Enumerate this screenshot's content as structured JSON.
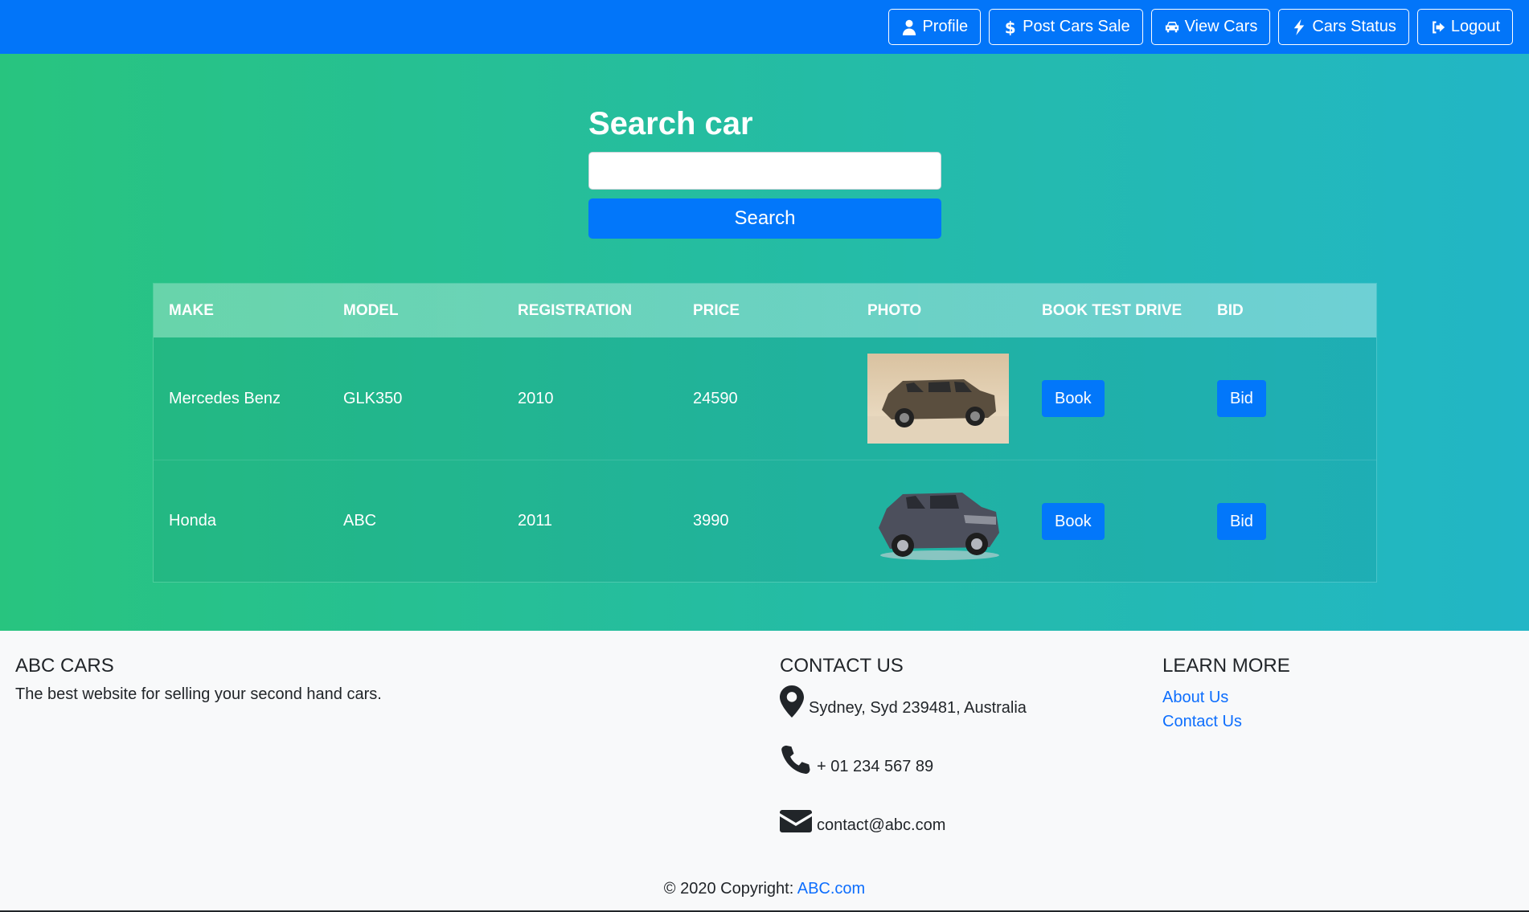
{
  "nav": {
    "items": [
      {
        "label": "Profile",
        "icon": "user-icon"
      },
      {
        "label": "Post Cars Sale",
        "icon": "dollar-icon"
      },
      {
        "label": "View Cars",
        "icon": "car-icon"
      },
      {
        "label": "Cars Status",
        "icon": "bolt-icon"
      },
      {
        "label": "Logout",
        "icon": "logout-icon"
      }
    ]
  },
  "search": {
    "title": "Search car",
    "input_value": "",
    "placeholder": "",
    "button_label": "Search"
  },
  "table": {
    "headers": [
      "MAKE",
      "MODEL",
      "REGISTRATION",
      "PRICE",
      "PHOTO",
      "BOOK TEST DRIVE",
      "BID"
    ],
    "rows": [
      {
        "make": "Mercedes Benz",
        "model": "GLK350",
        "registration": "2010",
        "price": "24590",
        "photo": "suv-brown-photo",
        "book_label": "Book",
        "bid_label": "Bid"
      },
      {
        "make": "Honda",
        "model": "ABC",
        "registration": "2011",
        "price": "3990",
        "photo": "suv-grey-photo",
        "book_label": "Book",
        "bid_label": "Bid"
      }
    ]
  },
  "footer": {
    "brand_heading": "ABC CARS",
    "brand_text": "The best website for selling your second hand cars.",
    "contact_heading": "CONTACT US",
    "address": "Sydney, Syd 239481, Australia",
    "phone": "+ 01 234 567 89",
    "email": "contact@abc.com",
    "learn_heading": "LEARN MORE",
    "links": [
      "About Us",
      "Contact Us"
    ],
    "copyright_prefix": "© 2020 Copyright:",
    "copyright_link": "ABC.com"
  },
  "colors": {
    "navbar": "#0275f9",
    "button": "#0277fa",
    "gradient_start": "#28c47f",
    "gradient_end": "#22b6c6",
    "link": "#0d6efd"
  }
}
